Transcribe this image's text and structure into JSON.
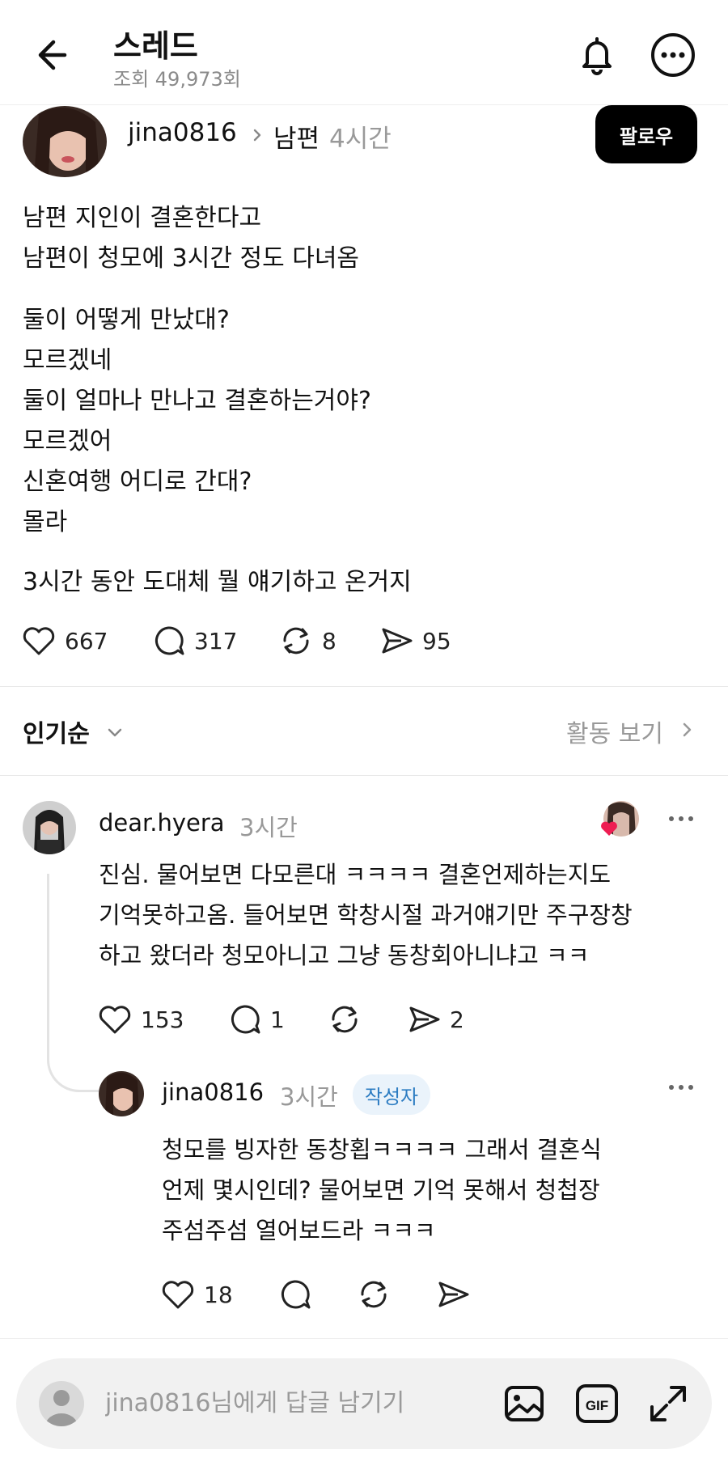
{
  "header": {
    "title": "스레드",
    "views": "조회 49,973회"
  },
  "post": {
    "username": "jina0816",
    "target": "남편",
    "time": "4시간",
    "follow_label": "팔로우",
    "lines": [
      "남편 지인이 결혼한다고",
      "남편이 청모에 3시간 정도 다녀옴",
      "둘이 어떻게 만났대?",
      "모르겠네",
      "둘이 얼마나 만나고 결혼하는거야?",
      "모르겠어",
      "신혼여행 어디로 간대?",
      "몰라",
      "3시간 동안 도대체 뭘 얘기하고 온거지"
    ],
    "likes": "667",
    "comments": "317",
    "reposts": "8",
    "shares": "95"
  },
  "sort": {
    "label": "인기순",
    "activity_link": "활동 보기"
  },
  "comments": [
    {
      "username": "dear.hyera",
      "time": "3시간",
      "lines": [
        "진심. 물어보면 다모른대 ㅋㅋㅋㅋ 결혼언제하는지도",
        "기억못하고옴. 들어보면 학창시절 과거얘기만 주구장창",
        "하고 왔더라 청모아니고 그냥 동창회아니냐고 ㅋㅋ"
      ],
      "likes": "153",
      "comments": "1",
      "shares": "2"
    },
    {
      "username": "jina0816",
      "time": "3시간",
      "badge": "작성자",
      "lines": [
        "청모를 빙자한 동창횝ㅋㅋㅋㅋ 그래서 결혼식",
        "언제 몇시인데? 물어보면 기억 못해서 청첩장",
        "주섬주섬 열어보드라 ㅋㅋㅋ"
      ],
      "likes": "18"
    }
  ],
  "reply_bar": {
    "placeholder": "jina0816님에게 답글 남기기"
  }
}
